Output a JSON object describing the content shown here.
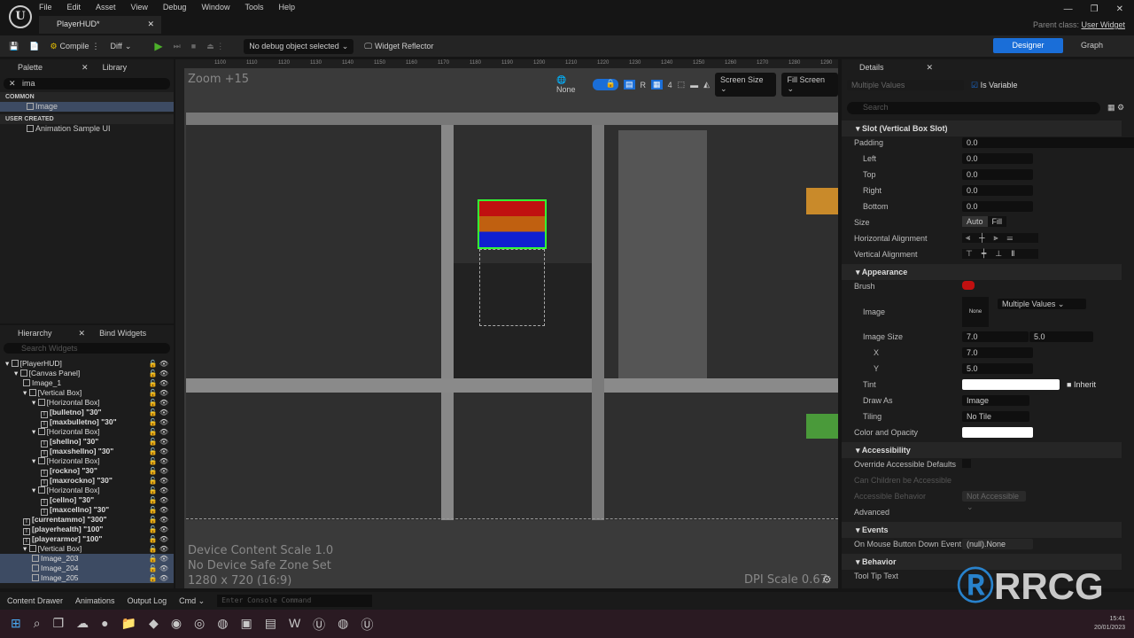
{
  "menu": [
    "File",
    "Edit",
    "Asset",
    "View",
    "Debug",
    "Window",
    "Tools",
    "Help"
  ],
  "tab": {
    "title": "PlayerHUD*"
  },
  "parent": {
    "label": "Parent class:",
    "value": "User Widget"
  },
  "toolbar": {
    "compile": "Compile",
    "diff": "Diff",
    "debug": "No debug object selected",
    "reflector": "Widget Reflector",
    "designer": "Designer",
    "graph": "Graph"
  },
  "palette": {
    "tab": "Palette",
    "library": "Library",
    "search": "ima",
    "common": "COMMON",
    "image": "Image",
    "user_created": "USER CREATED",
    "anim": "Animation Sample UI"
  },
  "hierarchy": {
    "tab": "Hierarchy",
    "bind": "Bind Widgets",
    "search_placeholder": "Search Widgets",
    "items": [
      {
        "t": "[PlayerHUD]",
        "d": 0
      },
      {
        "t": "[Canvas Panel]",
        "d": 1
      },
      {
        "t": "Image_1",
        "d": 2
      },
      {
        "t": "[Vertical Box]",
        "d": 2
      },
      {
        "t": "[Horizontal Box]",
        "d": 3
      },
      {
        "t": "[bulletno] \"30\"",
        "d": 4
      },
      {
        "t": "[maxbulletno] \"30\"",
        "d": 4
      },
      {
        "t": "[Horizontal Box]",
        "d": 3
      },
      {
        "t": "[shellno] \"30\"",
        "d": 4
      },
      {
        "t": "[maxshellno] \"30\"",
        "d": 4
      },
      {
        "t": "[Horizontal Box]",
        "d": 3
      },
      {
        "t": "[rockno] \"30\"",
        "d": 4
      },
      {
        "t": "[maxrockno] \"30\"",
        "d": 4
      },
      {
        "t": "[Horizontal Box]",
        "d": 3
      },
      {
        "t": "[cellno] \"30\"",
        "d": 4
      },
      {
        "t": "[maxcellno] \"30\"",
        "d": 4
      },
      {
        "t": "[currentammo] \"300\"",
        "d": 2
      },
      {
        "t": "[playerhealth] \"100\"",
        "d": 2
      },
      {
        "t": "[playerarmor] \"100\"",
        "d": 2
      },
      {
        "t": "[Vertical Box]",
        "d": 2
      },
      {
        "t": "Image_203",
        "d": 3,
        "s": true
      },
      {
        "t": "Image_204",
        "d": 3,
        "s": true
      },
      {
        "t": "Image_205",
        "d": 3,
        "s": true
      }
    ]
  },
  "viewport": {
    "zoom": "Zoom +15",
    "none": "None",
    "r": "R",
    "grid": "4",
    "screen_size": "Screen Size",
    "fill": "Fill Screen",
    "ruler": [
      "1100",
      "1110",
      "1120",
      "1130",
      "1140",
      "1150",
      "1160",
      "1170",
      "1180",
      "1190",
      "1200",
      "1210",
      "1220",
      "1230",
      "1240",
      "1250",
      "1260",
      "1270",
      "1280",
      "1290"
    ],
    "scale": "Device Content Scale 1.0",
    "safe": "No Device Safe Zone Set",
    "res": "1280 x 720 (16:9)",
    "dpi": "DPI Scale 0.67"
  },
  "details": {
    "tab": "Details",
    "name": "Multiple Values",
    "is_variable": "Is Variable",
    "search": "Search",
    "slot": "Slot (Vertical Box Slot)",
    "padding": "Padding",
    "padding_v": "0.0",
    "left": "Left",
    "top": "Top",
    "right": "Right",
    "bottom": "Bottom",
    "val0": "0.0",
    "size": "Size",
    "auto": "Auto",
    "fill": "Fill",
    "halign": "Horizontal Alignment",
    "valign": "Vertical Alignment",
    "appearance": "Appearance",
    "brush": "Brush",
    "image": "Image",
    "none": "None",
    "multiple": "Multiple Values",
    "image_size": "Image Size",
    "x": "X",
    "y": "Y",
    "xv": "7.0",
    "yv": "5.0",
    "tint": "Tint",
    "inherit": "Inherit",
    "draw_as": "Draw As",
    "draw_as_v": "Image",
    "tiling": "Tiling",
    "tiling_v": "No Tile",
    "color": "Color and Opacity",
    "accessibility": "Accessibility",
    "override": "Override Accessible Defaults",
    "children": "Can Children be Accessible",
    "behavior_a": "Accessible Behavior",
    "not_acc": "Not Accessible",
    "advanced": "Advanced",
    "events": "Events",
    "mouse": "On Mouse Button Down Event",
    "null": "(null).None",
    "behavior": "Behavior",
    "tooltip": "Tool Tip Text"
  },
  "status": {
    "drawer": "Content Drawer",
    "anim": "Animations",
    "log": "Output Log",
    "cmd": "Cmd",
    "console_placeholder": "Enter Console Command"
  },
  "clock": {
    "time": "15:41",
    "date": "20/01/2023"
  },
  "watermark": "RRCG",
  "colors": {
    "accent": "#1a6ed8",
    "selection": "#3d4b63"
  }
}
